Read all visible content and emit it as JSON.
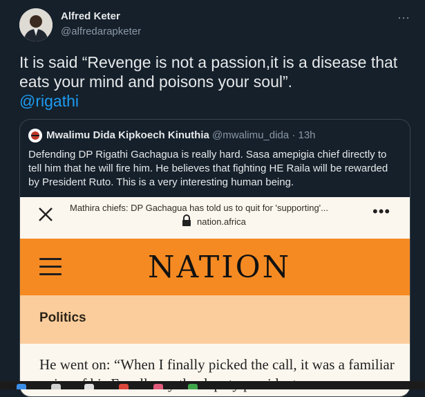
{
  "tweet": {
    "author_name": "Alfred Keter",
    "author_handle": "@alfredarapketer",
    "more_icon": "more-horizontal-icon",
    "text": "It is said “Revenge is not a passion,it is a disease that eats your mind and poisons your soul”.",
    "mention": "@rigathi"
  },
  "quote": {
    "author_name": "Mwalimu Dida Kipkoech Kinuthia",
    "author_handle": "@mwalimu_dida",
    "separator": "·",
    "time": "13h",
    "text": "Defending DP Rigathi Gachagua is really hard. Sasa amepigia chief directly to tell him that he will fire him. He believes that fighting HE Raila will be rewarded by President Ruto. This is a very interesting human being."
  },
  "screenshot": {
    "page_title": "Mathira chiefs: DP Gachagua has told us to quit for 'supporting'...",
    "page_url": "nation.africa",
    "brand": "NATION",
    "section": "Politics",
    "article_text": "He went on: “When I finally picked the call, it was a familiar voice of his Excellency the deputy president"
  },
  "colors": {
    "background": "#15202b",
    "link": "#1d9bf0",
    "nation_orange": "#f58a22",
    "section_peach": "#fbcd9c"
  }
}
